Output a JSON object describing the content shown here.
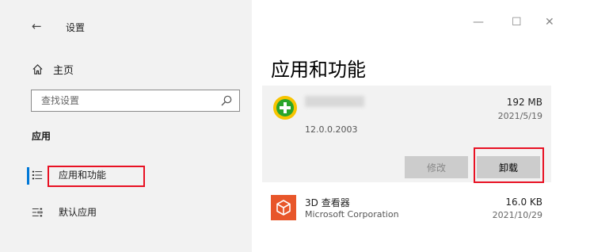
{
  "window": {
    "title": "设置",
    "back_glyph": "←",
    "minimize_glyph": "—",
    "maximize_glyph": "☐",
    "close_glyph": "✕"
  },
  "sidebar": {
    "home_label": "主页",
    "search_placeholder": "查找设置",
    "section_title": "应用",
    "items": [
      {
        "label": "应用和功能",
        "icon": "apps-list-icon",
        "active": true
      },
      {
        "label": "默认应用",
        "icon": "default-apps-icon",
        "active": false
      }
    ]
  },
  "main": {
    "title": "应用和功能",
    "apps": [
      {
        "name": "",
        "size": "192 MB",
        "date": "2021/5/19",
        "version": "12.0.0.2003",
        "expanded": true,
        "icon": "green-plus-shield-icon",
        "buttons": {
          "modify": "修改",
          "uninstall": "卸载"
        }
      },
      {
        "name": "3D 查看器",
        "publisher": "Microsoft Corporation",
        "size": "16.0 KB",
        "date": "2021/10/29",
        "expanded": false,
        "icon": "3d-viewer-icon"
      }
    ]
  },
  "colors": {
    "accent": "#0078d7",
    "highlight": "#e81123",
    "sidebar_bg": "#f2f2f2",
    "viewer_icon_bg": "#e8562a"
  }
}
